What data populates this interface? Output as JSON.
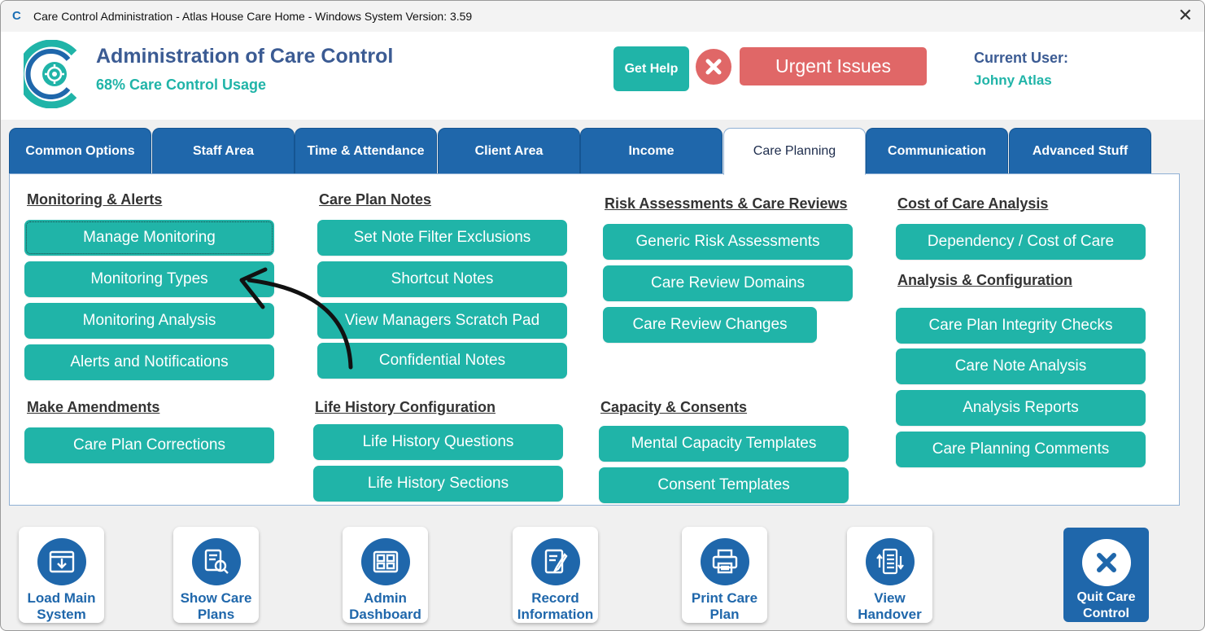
{
  "window": {
    "title": "Care Control Administration - Atlas House Care Home - Windows System Version: 3.59",
    "app_icon": "C",
    "close_glyph": "✕"
  },
  "header": {
    "title": "Administration of Care Control",
    "usage": "68% Care Control Usage",
    "help_label": "Get Help",
    "urgent_label": "Urgent Issues",
    "current_user_label": "Current User:",
    "current_user_name": "Johny Atlas"
  },
  "tabs": [
    {
      "label": "Common Options",
      "active": false
    },
    {
      "label": "Staff Area",
      "active": false
    },
    {
      "label": "Time & Attendance",
      "active": false
    },
    {
      "label": "Client Area",
      "active": false
    },
    {
      "label": "Income",
      "active": false
    },
    {
      "label": "Care Planning",
      "active": true
    },
    {
      "label": "Communication",
      "active": false
    },
    {
      "label": "Advanced Stuff",
      "active": false
    }
  ],
  "columns": {
    "monitoring": {
      "heading": "Monitoring & Alerts",
      "buttons": [
        "Manage Monitoring",
        "Monitoring Types",
        "Monitoring Analysis",
        "Alerts and Notifications"
      ]
    },
    "amendments": {
      "heading": "Make Amendments",
      "buttons": [
        "Care Plan Corrections"
      ]
    },
    "notes": {
      "heading": "Care Plan Notes",
      "buttons": [
        "Set Note Filter Exclusions",
        "Shortcut Notes",
        "View Managers Scratch Pad",
        "Confidential Notes"
      ]
    },
    "life_history": {
      "heading": "Life History Configuration",
      "buttons": [
        "Life History Questions",
        "Life History Sections"
      ]
    },
    "risk": {
      "heading": "Risk Assessments & Care Reviews",
      "buttons": [
        "Generic Risk Assessments",
        "Care Review Domains",
        "Care Review Changes"
      ]
    },
    "capacity": {
      "heading": "Capacity & Consents",
      "buttons": [
        "Mental Capacity Templates",
        "Consent Templates"
      ]
    },
    "cost": {
      "heading": "Cost of Care Analysis",
      "buttons": [
        "Dependency / Cost of Care"
      ]
    },
    "analysis": {
      "heading": "Analysis & Configuration",
      "buttons": [
        "Care Plan Integrity Checks",
        "Care Note Analysis",
        "Analysis Reports",
        "Care Planning Comments"
      ]
    }
  },
  "toolbar": [
    {
      "label": "Load Main\nSystem",
      "icon": "load-system-icon"
    },
    {
      "label": "Show Care\nPlans",
      "icon": "care-plans-icon"
    },
    {
      "label": "Admin\nDashboard",
      "icon": "dashboard-icon"
    },
    {
      "label": "Record\nInformation",
      "icon": "record-icon"
    },
    {
      "label": "Print Care\nPlan",
      "icon": "printer-icon"
    },
    {
      "label": "View\nHandover",
      "icon": "handover-icon"
    }
  ],
  "quit": {
    "label": "Quit Care\nControl",
    "icon": "close-circle-icon"
  },
  "colors": {
    "teal": "#20b4a8",
    "navy": "#1f67ab",
    "title_blue": "#3b5b93",
    "urgent_red": "#e06767"
  }
}
